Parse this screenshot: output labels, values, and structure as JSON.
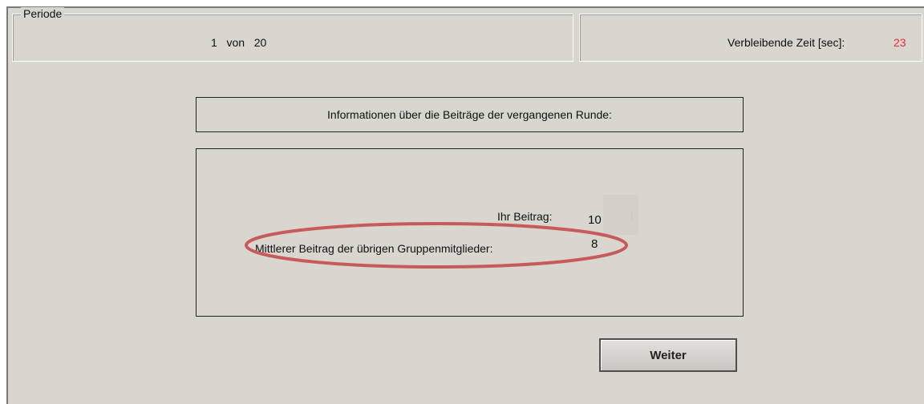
{
  "period": {
    "legend": "Periode",
    "current": "1",
    "separator": "von",
    "total": "20"
  },
  "timer": {
    "label": "Verbleibende Zeit [sec]:",
    "value": "23",
    "value_color": "#e03030"
  },
  "info": {
    "header": "Informationen über die Beiträge der vergangenen Runde:",
    "own_contribution_label": "Ihr Beitrag:",
    "own_contribution_value": "10",
    "avg_contribution_label": "Mittlerer Beitrag der übrigen Gruppenmitglieder:",
    "avg_contribution_value": "8",
    "highlight_color": "#c75b5b"
  },
  "actions": {
    "continue_label": "Weiter"
  }
}
